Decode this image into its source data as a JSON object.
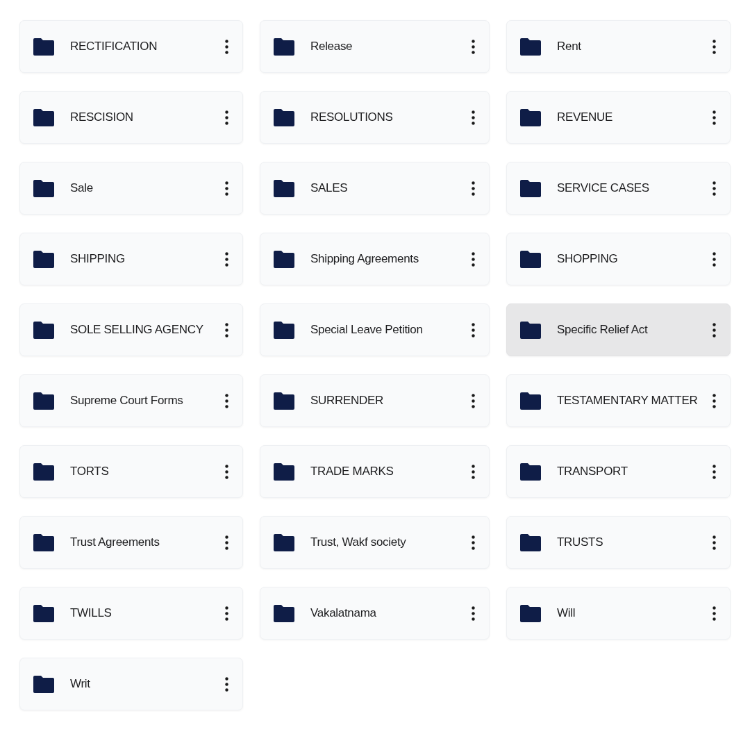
{
  "folders": [
    {
      "name": "RECTIFICATION",
      "selected": false
    },
    {
      "name": "Release",
      "selected": false
    },
    {
      "name": "Rent",
      "selected": false
    },
    {
      "name": "RESCISION",
      "selected": false
    },
    {
      "name": "RESOLUTIONS",
      "selected": false
    },
    {
      "name": "REVENUE",
      "selected": false
    },
    {
      "name": "Sale",
      "selected": false
    },
    {
      "name": "SALES",
      "selected": false
    },
    {
      "name": "SERVICE CASES",
      "selected": false
    },
    {
      "name": "SHIPPING",
      "selected": false
    },
    {
      "name": "Shipping Agreements",
      "selected": false
    },
    {
      "name": "SHOPPING",
      "selected": false
    },
    {
      "name": "SOLE SELLING AGENCY",
      "selected": false
    },
    {
      "name": "Special Leave Petition",
      "selected": false
    },
    {
      "name": "Specific Relief Act",
      "selected": true
    },
    {
      "name": "Supreme Court Forms",
      "selected": false
    },
    {
      "name": "SURRENDER",
      "selected": false
    },
    {
      "name": "TESTAMENTARY MATTER",
      "selected": false
    },
    {
      "name": "TORTS",
      "selected": false
    },
    {
      "name": "TRADE MARKS",
      "selected": false
    },
    {
      "name": "TRANSPORT",
      "selected": false
    },
    {
      "name": "Trust Agreements",
      "selected": false
    },
    {
      "name": "Trust, Wakf society",
      "selected": false
    },
    {
      "name": "TRUSTS",
      "selected": false
    },
    {
      "name": "TWILLS",
      "selected": false
    },
    {
      "name": "Vakalatnama",
      "selected": false
    },
    {
      "name": "Will",
      "selected": false
    },
    {
      "name": "Writ",
      "selected": false
    }
  ]
}
